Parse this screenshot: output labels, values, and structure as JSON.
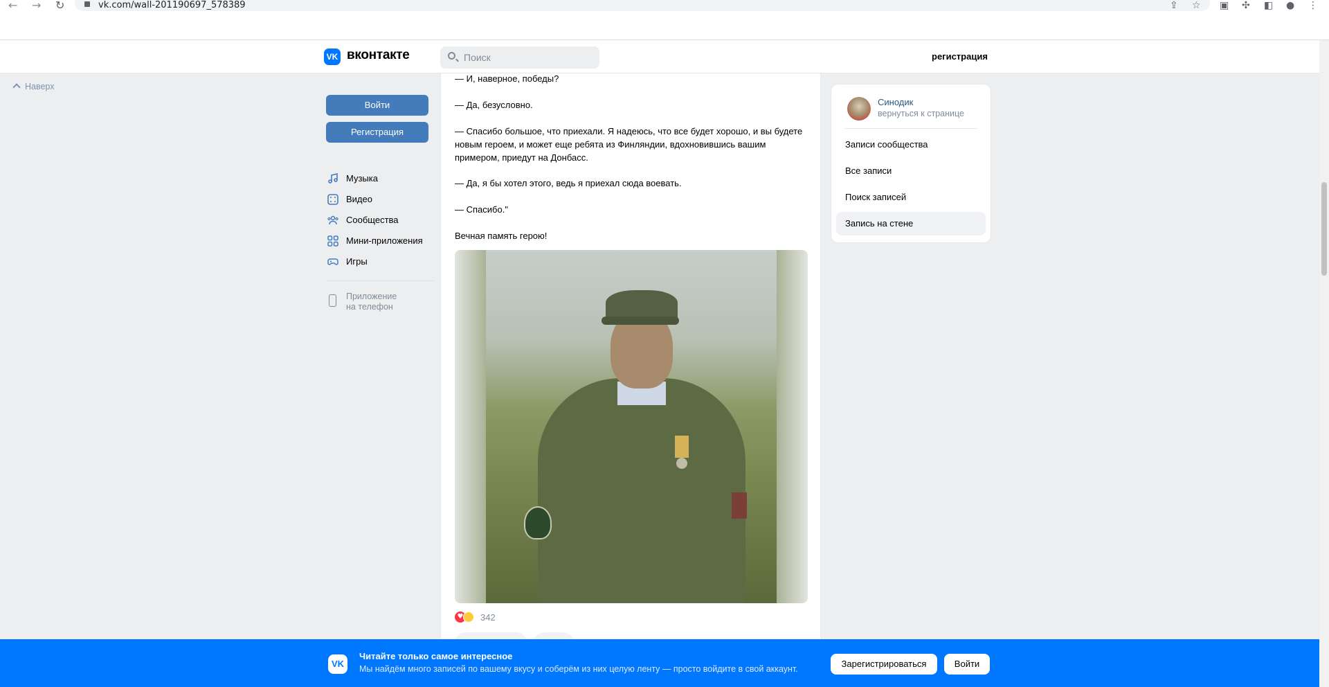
{
  "browser": {
    "url": "vk.com/wall-201190697_578389"
  },
  "header": {
    "logo_mark": "VK",
    "logo_text": "вконтакте",
    "search_placeholder": "Поиск",
    "register_link": "регистрация"
  },
  "to_top": "Наверх",
  "sidebar": {
    "login_button": "Войти",
    "register_button": "Регистрация",
    "items": [
      {
        "label": "Музыка",
        "icon": "music-icon"
      },
      {
        "label": "Видео",
        "icon": "video-icon"
      },
      {
        "label": "Сообщества",
        "icon": "communities-icon"
      },
      {
        "label": "Мини-приложения",
        "icon": "mini-apps-icon"
      },
      {
        "label": "Игры",
        "icon": "games-icon"
      }
    ],
    "app_phone_line1": "Приложение",
    "app_phone_line2": "на телефон"
  },
  "post": {
    "paragraphs": [
      "— И, наверное, победы?",
      "— Да, безусловно.",
      "— Спасибо большое, что приехали. Я надеюсь, что все будет хорошо, и вы будете новым героем, и может еще ребята из Финляндии, вдохновившись вашим примером, приедут на Донбасс.",
      "— Да, я бы хотел этого, ведь я приехал сюда воевать.",
      "— Спасибо.\"",
      "Вечная память герою!"
    ],
    "reactions_count": "342"
  },
  "right": {
    "community_name": "Синодик",
    "back_link": "вернуться к странице",
    "items": [
      "Записи сообщества",
      "Все записи",
      "Поиск записей",
      "Запись на стене"
    ]
  },
  "banner": {
    "logo_mark": "VK",
    "title": "Читайте только самое интересное",
    "subtitle": "Мы найдём много записей по вашему вкусу и соберём из них целую ленту — просто войдите в свой аккаунт.",
    "register_button": "Зарегистрироваться",
    "login_button": "Войти"
  },
  "colors": {
    "vk_blue": "#0077ff",
    "sidebar_button": "#447bba",
    "link": "#2a5885"
  }
}
